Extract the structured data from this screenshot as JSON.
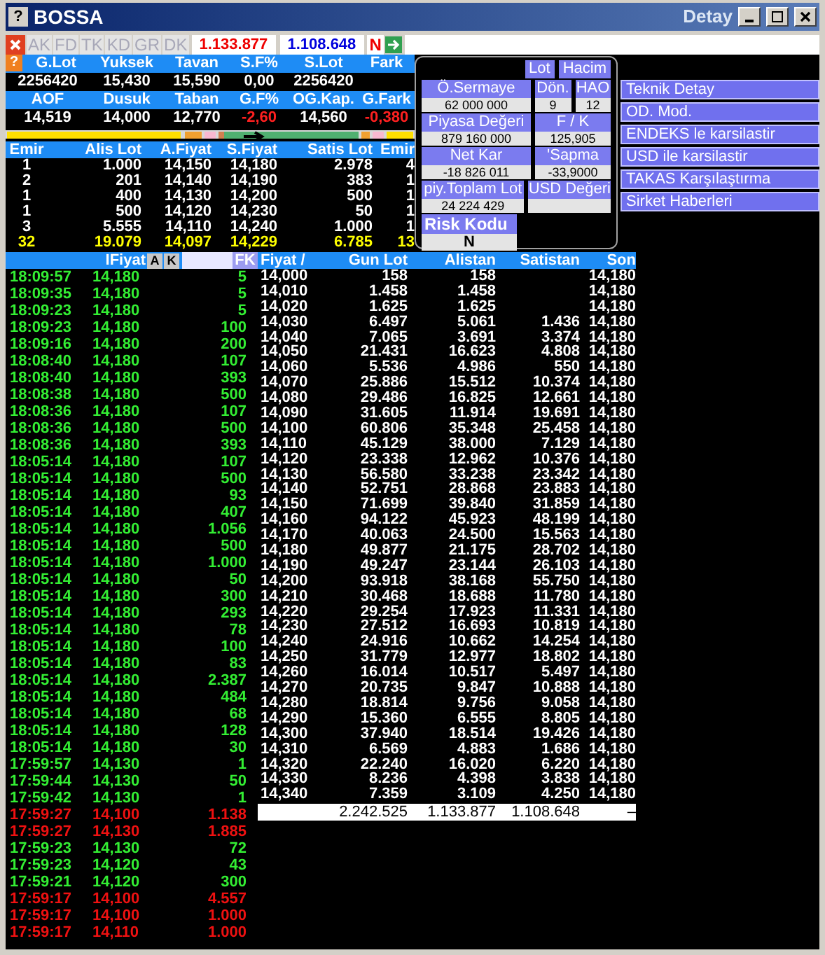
{
  "window": {
    "help": "?",
    "title": "BOSSA",
    "subtitle": "Detay"
  },
  "toolbar": {
    "buttons": [
      {
        "label": "AK",
        "disabled": true
      },
      {
        "label": "FD",
        "disabled": true
      },
      {
        "label": "TK",
        "disabled": true
      },
      {
        "label": "KD",
        "disabled": true
      },
      {
        "label": "GR",
        "disabled": true
      },
      {
        "label": "DK",
        "disabled": true
      }
    ],
    "readouts": [
      {
        "value": "1.133.877",
        "color": "#ee0000"
      },
      {
        "value": "1.108.648",
        "color": "#0000dd"
      }
    ],
    "flag": "N"
  },
  "stats": {
    "help": "?",
    "rows": [
      [
        {
          "label": "G.Lot",
          "value": "2256420",
          "negative": false
        },
        {
          "label": "Yuksek",
          "value": "15,430",
          "negative": false
        },
        {
          "label": "Tavan",
          "value": "15,590",
          "negative": false
        },
        {
          "label": "S.F%",
          "value": "0,00",
          "negative": false
        },
        {
          "label": "S.Lot",
          "value": "2256420",
          "negative": false
        },
        {
          "label": "Fark"
        }
      ],
      [
        {
          "label": "AOF",
          "value": "14,519",
          "negative": false
        },
        {
          "label": "Dusuk",
          "value": "14,000",
          "negative": false
        },
        {
          "label": "Taban",
          "value": "12,770",
          "negative": false
        },
        {
          "label": "G.F%",
          "value": "-2,60",
          "negative": true
        },
        {
          "label": "OG.Kap.",
          "value": "14,560",
          "negative": false
        },
        {
          "label": "G.Fark",
          "value": "-0,380",
          "negative": true
        }
      ]
    ]
  },
  "order_book": {
    "columns": [
      "Emir",
      "Alis Lot",
      "A.Fiyat",
      "S.Fiyat",
      "Satis Lot",
      "Emir"
    ],
    "rows": [
      [
        "1",
        "1.000",
        "14,150",
        "14,180",
        "2.978",
        "4"
      ],
      [
        "2",
        "201",
        "14,140",
        "14,190",
        "383",
        "1"
      ],
      [
        "1",
        "400",
        "14,130",
        "14,200",
        "500",
        "1"
      ],
      [
        "1",
        "500",
        "14,120",
        "14,230",
        "50",
        "1"
      ],
      [
        "3",
        "5.555",
        "14,110",
        "14,240",
        "1.000",
        "1"
      ]
    ],
    "totals": [
      "32",
      "19.079",
      "14,097",
      "14,229",
      "6.785",
      "13"
    ]
  },
  "fundamentals": {
    "tabs": [
      {
        "label": "Lot",
        "selected": false
      },
      {
        "label": "Hacim",
        "selected": false
      }
    ],
    "rows": [
      [
        {
          "label": "Ö.Sermaye",
          "value": "62 000 000"
        },
        {
          "label": "Dön.",
          "value": "9"
        },
        {
          "label": "HAO",
          "value": "12"
        }
      ],
      [
        {
          "label": "Piyasa Değeri",
          "value": "879 160 000"
        },
        {
          "label": "F / K",
          "value": "125,905"
        }
      ],
      [
        {
          "label": "Net Kar",
          "value": "-18 826 011"
        },
        {
          "label": "'Sapma",
          "value": "-33,9000"
        }
      ],
      [
        {
          "label": "piy.Toplam Lot",
          "value": "24 224 429"
        },
        {
          "label": "USD Değeri"
        }
      ]
    ],
    "risk": {
      "label": "Risk Kodu",
      "value": "N"
    }
  },
  "actions": [
    "Teknik Detay",
    "OD. Mod.",
    "ENDEKS le karsilastir",
    "USD ile karsilastir",
    "TAKAS Karşılaştırma",
    "Sirket Haberleri"
  ],
  "trades": {
    "header": "IFiyat",
    "buttons": [
      "A",
      "K"
    ],
    "filter_button": "FK",
    "rows": [
      {
        "time": "18:09:57",
        "price": "14,180",
        "lot": "5",
        "color": "#33ee33"
      },
      {
        "time": "18:09:35",
        "price": "14,180",
        "lot": "5",
        "color": "#33ee33"
      },
      {
        "time": "18:09:23",
        "price": "14,180",
        "lot": "5",
        "color": "#33ee33"
      },
      {
        "time": "18:09:23",
        "price": "14,180",
        "lot": "100",
        "color": "#33ee33"
      },
      {
        "time": "18:09:16",
        "price": "14,180",
        "lot": "200",
        "color": "#33ee33"
      },
      {
        "time": "18:08:40",
        "price": "14,180",
        "lot": "107",
        "color": "#33ee33"
      },
      {
        "time": "18:08:40",
        "price": "14,180",
        "lot": "393",
        "color": "#33ee33"
      },
      {
        "time": "18:08:38",
        "price": "14,180",
        "lot": "500",
        "color": "#33ee33"
      },
      {
        "time": "18:08:36",
        "price": "14,180",
        "lot": "107",
        "color": "#33ee33"
      },
      {
        "time": "18:08:36",
        "price": "14,180",
        "lot": "500",
        "color": "#33ee33"
      },
      {
        "time": "18:08:36",
        "price": "14,180",
        "lot": "393",
        "color": "#33ee33"
      },
      {
        "time": "18:05:14",
        "price": "14,180",
        "lot": "107",
        "color": "#33ee33"
      },
      {
        "time": "18:05:14",
        "price": "14,180",
        "lot": "500",
        "color": "#33ee33"
      },
      {
        "time": "18:05:14",
        "price": "14,180",
        "lot": "93",
        "color": "#33ee33"
      },
      {
        "time": "18:05:14",
        "price": "14,180",
        "lot": "407",
        "color": "#33ee33"
      },
      {
        "time": "18:05:14",
        "price": "14,180",
        "lot": "1.056",
        "color": "#33ee33"
      },
      {
        "time": "18:05:14",
        "price": "14,180",
        "lot": "500",
        "color": "#33ee33"
      },
      {
        "time": "18:05:14",
        "price": "14,180",
        "lot": "1.000",
        "color": "#33ee33"
      },
      {
        "time": "18:05:14",
        "price": "14,180",
        "lot": "50",
        "color": "#33ee33"
      },
      {
        "time": "18:05:14",
        "price": "14,180",
        "lot": "300",
        "color": "#33ee33"
      },
      {
        "time": "18:05:14",
        "price": "14,180",
        "lot": "293",
        "color": "#33ee33"
      },
      {
        "time": "18:05:14",
        "price": "14,180",
        "lot": "78",
        "color": "#33ee33"
      },
      {
        "time": "18:05:14",
        "price": "14,180",
        "lot": "100",
        "color": "#33ee33"
      },
      {
        "time": "18:05:14",
        "price": "14,180",
        "lot": "83",
        "color": "#33ee33"
      },
      {
        "time": "18:05:14",
        "price": "14,180",
        "lot": "2.387",
        "color": "#33ee33"
      },
      {
        "time": "18:05:14",
        "price": "14,180",
        "lot": "484",
        "color": "#33ee33"
      },
      {
        "time": "18:05:14",
        "price": "14,180",
        "lot": "68",
        "color": "#33ee33"
      },
      {
        "time": "18:05:14",
        "price": "14,180",
        "lot": "128",
        "color": "#33ee33"
      },
      {
        "time": "18:05:14",
        "price": "14,180",
        "lot": "30",
        "color": "#33ee33"
      },
      {
        "time": "17:59:57",
        "price": "14,130",
        "lot": "1",
        "color": "#33ee33"
      },
      {
        "time": "17:59:44",
        "price": "14,130",
        "lot": "50",
        "color": "#33ee33"
      },
      {
        "time": "17:59:42",
        "price": "14,130",
        "lot": "1",
        "color": "#33ee33"
      },
      {
        "time": "17:59:27",
        "price": "14,100",
        "lot": "1.138",
        "color": "#ee1111"
      },
      {
        "time": "17:59:27",
        "price": "14,130",
        "lot": "1.885",
        "color": "#ee1111"
      },
      {
        "time": "17:59:23",
        "price": "14,130",
        "lot": "72",
        "color": "#33ee33"
      },
      {
        "time": "17:59:23",
        "price": "14,120",
        "lot": "43",
        "color": "#33ee33"
      },
      {
        "time": "17:59:21",
        "price": "14,120",
        "lot": "300",
        "color": "#33ee33"
      },
      {
        "time": "17:59:17",
        "price": "14,100",
        "lot": "4.557",
        "color": "#ee1111"
      },
      {
        "time": "17:59:17",
        "price": "14,100",
        "lot": "1.000",
        "color": "#ee1111"
      },
      {
        "time": "17:59:17",
        "price": "14,110",
        "lot": "1.000",
        "color": "#ee1111"
      }
    ]
  },
  "price_table": {
    "columns": [
      "Fiyat /",
      "Gun Lot",
      "Alistan",
      "Satistan",
      "Son"
    ],
    "rows": [
      {
        "price": "14,000",
        "gun_lot": "158",
        "alistan": "158",
        "son": "14,180"
      },
      {
        "price": "14,010",
        "gun_lot": "1.458",
        "alistan": "1.458",
        "son": "14,180"
      },
      {
        "price": "14,020",
        "gun_lot": "1.625",
        "alistan": "1.625",
        "son": "14,180"
      },
      {
        "price": "14,030",
        "gun_lot": "6.497",
        "alistan": "5.061",
        "satistan": "1.436",
        "son": "14,180"
      },
      {
        "price": "14,040",
        "gun_lot": "7.065",
        "alistan": "3.691",
        "satistan": "3.374",
        "son": "14,180"
      },
      {
        "price": "14,050",
        "gun_lot": "21.431",
        "alistan": "16.623",
        "satistan": "4.808",
        "son": "14,180"
      },
      {
        "price": "14,060",
        "gun_lot": "5.536",
        "alistan": "4.986",
        "satistan": "550",
        "son": "14,180"
      },
      {
        "price": "14,070",
        "gun_lot": "25.886",
        "alistan": "15.512",
        "satistan": "10.374",
        "son": "14,180"
      },
      {
        "price": "14,080",
        "gun_lot": "29.486",
        "alistan": "16.825",
        "satistan": "12.661",
        "son": "14,180"
      },
      {
        "price": "14,090",
        "gun_lot": "31.605",
        "alistan": "11.914",
        "satistan": "19.691",
        "son": "14,180"
      },
      {
        "price": "14,100",
        "gun_lot": "60.806",
        "alistan": "35.348",
        "satistan": "25.458",
        "son": "14,180"
      },
      {
        "price": "14,110",
        "gun_lot": "45.129",
        "alistan": "38.000",
        "satistan": "7.129",
        "son": "14,180"
      },
      {
        "price": "14,120",
        "gun_lot": "23.338",
        "alistan": "12.962",
        "satistan": "10.376",
        "son": "14,180"
      },
      {
        "price": "14,130",
        "gun_lot": "56.580",
        "alistan": "33.238",
        "satistan": "23.342",
        "son": "14,180"
      },
      {
        "price": "14,140",
        "gun_lot": "52.751",
        "alistan": "28.868",
        "satistan": "23.883",
        "son": "14,180"
      },
      {
        "price": "14,150",
        "gun_lot": "71.699",
        "alistan": "39.840",
        "satistan": "31.859",
        "son": "14,180"
      },
      {
        "price": "14,160",
        "gun_lot": "94.122",
        "alistan": "45.923",
        "satistan": "48.199",
        "son": "14,180"
      },
      {
        "price": "14,170",
        "gun_lot": "40.063",
        "alistan": "24.500",
        "satistan": "15.563",
        "son": "14,180"
      },
      {
        "price": "14,180",
        "gun_lot": "49.877",
        "alistan": "21.175",
        "satistan": "28.702",
        "son": "14,180"
      },
      {
        "price": "14,190",
        "gun_lot": "49.247",
        "alistan": "23.144",
        "satistan": "26.103",
        "son": "14,180"
      },
      {
        "price": "14,200",
        "gun_lot": "93.918",
        "alistan": "38.168",
        "satistan": "55.750",
        "son": "14,180"
      },
      {
        "price": "14,210",
        "gun_lot": "30.468",
        "alistan": "18.688",
        "satistan": "11.780",
        "son": "14,180"
      },
      {
        "price": "14,220",
        "gun_lot": "29.254",
        "alistan": "17.923",
        "satistan": "11.331",
        "son": "14,180"
      },
      {
        "price": "14,230",
        "gun_lot": "27.512",
        "alistan": "16.693",
        "satistan": "10.819",
        "son": "14,180"
      },
      {
        "price": "14,240",
        "gun_lot": "24.916",
        "alistan": "10.662",
        "satistan": "14.254",
        "son": "14,180"
      },
      {
        "price": "14,250",
        "gun_lot": "31.779",
        "alistan": "12.977",
        "satistan": "18.802",
        "son": "14,180"
      },
      {
        "price": "14,260",
        "gun_lot": "16.014",
        "alistan": "10.517",
        "satistan": "5.497",
        "son": "14,180"
      },
      {
        "price": "14,270",
        "gun_lot": "20.735",
        "alistan": "9.847",
        "satistan": "10.888",
        "son": "14,180"
      },
      {
        "price": "14,280",
        "gun_lot": "18.814",
        "alistan": "9.756",
        "satistan": "9.058",
        "son": "14,180"
      },
      {
        "price": "14,290",
        "gun_lot": "15.360",
        "alistan": "6.555",
        "satistan": "8.805",
        "son": "14,180"
      },
      {
        "price": "14,300",
        "gun_lot": "37.940",
        "alistan": "18.514",
        "satistan": "19.426",
        "son": "14,180"
      },
      {
        "price": "14,310",
        "gun_lot": "6.569",
        "alistan": "4.883",
        "satistan": "1.686",
        "son": "14,180"
      },
      {
        "price": "14,320",
        "gun_lot": "22.240",
        "alistan": "16.020",
        "satistan": "6.220",
        "son": "14,180"
      },
      {
        "price": "14,330",
        "gun_lot": "8.236",
        "alistan": "4.398",
        "satistan": "3.838",
        "son": "14,180"
      },
      {
        "price": "14,340",
        "gun_lot": "7.359",
        "alistan": "3.109",
        "satistan": "4.250",
        "son": "14,180"
      }
    ],
    "totals": {
      "gun_lot": "2.242.525",
      "alistan": "1.133.877",
      "satistan": "1.108.648",
      "son": "–"
    }
  }
}
